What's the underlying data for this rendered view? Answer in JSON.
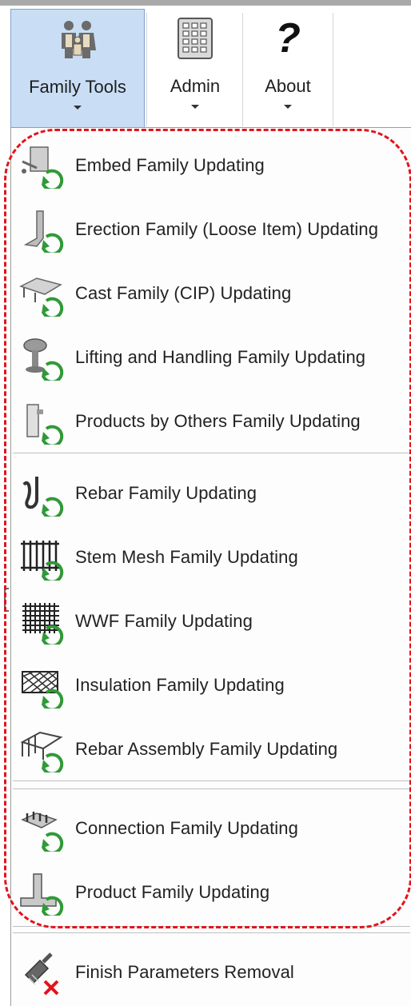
{
  "ribbon": {
    "tabs": [
      {
        "label": "Family Tools",
        "icon": "family-icon",
        "selected": true
      },
      {
        "label": "Admin",
        "icon": "keypad-icon",
        "selected": false
      },
      {
        "label": "About",
        "icon": "question-icon",
        "selected": false,
        "glyph": "?"
      }
    ]
  },
  "menu": {
    "groups": [
      {
        "items": [
          {
            "label": "Embed Family Updating",
            "icon": "embed-update-icon"
          },
          {
            "label": "Erection Family (Loose Item) Updating",
            "icon": "erection-update-icon"
          },
          {
            "label": "Cast Family (CIP) Updating",
            "icon": "cast-update-icon"
          },
          {
            "label": "Lifting and Handling Family Updating",
            "icon": "lifting-update-icon"
          },
          {
            "label": "Products by Others Family Updating",
            "icon": "products-others-update-icon"
          }
        ]
      },
      {
        "items": [
          {
            "label": "Rebar Family Updating",
            "icon": "rebar-update-icon"
          },
          {
            "label": "Stem Mesh Family Updating",
            "icon": "stem-mesh-update-icon"
          },
          {
            "label": "WWF Family Updating",
            "icon": "wwf-update-icon"
          },
          {
            "label": "Insulation Family Updating",
            "icon": "insulation-update-icon"
          },
          {
            "label": "Rebar Assembly Family Updating",
            "icon": "rebar-assembly-update-icon"
          }
        ]
      },
      {
        "items": [
          {
            "label": "Connection Family Updating",
            "icon": "connection-update-icon"
          },
          {
            "label": "Product Family Updating",
            "icon": "product-update-icon"
          }
        ]
      },
      {
        "items": [
          {
            "label": "Finish Parameters Removal",
            "icon": "finish-removal-icon"
          }
        ]
      }
    ]
  },
  "colors": {
    "selected_tab_bg": "#c9def5",
    "selected_tab_border": "#7da2ce",
    "highlight_dash": "#e3131b",
    "refresh_arrow": "#2f9a36"
  }
}
